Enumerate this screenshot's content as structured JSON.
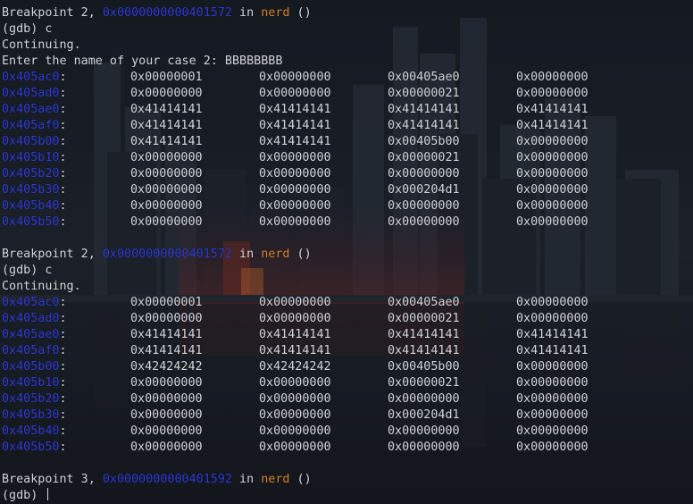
{
  "colors": {
    "background": "#15181f",
    "text": "#d3d6dc",
    "address": "#2f3bd6",
    "function": "#d7832a"
  },
  "blocks": [
    {
      "breakpoint": {
        "prefix": "Breakpoint 2, ",
        "address": "0x0000000000401572",
        "mid": " in ",
        "fn": "nerd",
        "suffix": " ()"
      },
      "prompt": "(gdb) c",
      "status": "Continuing.",
      "input_line": "Enter the name of your case 2: BBBBBBBB",
      "rows": [
        {
          "addr": "0x405ac0",
          "sep": ":",
          "words": [
            "0x00000001",
            "0x00000000",
            "0x00405ae0",
            "0x00000000"
          ]
        },
        {
          "addr": "0x405ad0",
          "sep": ":",
          "words": [
            "0x00000000",
            "0x00000000",
            "0x00000021",
            "0x00000000"
          ]
        },
        {
          "addr": "0x405ae0",
          "sep": ":",
          "words": [
            "0x41414141",
            "0x41414141",
            "0x41414141",
            "0x41414141"
          ]
        },
        {
          "addr": "0x405af0",
          "sep": ":",
          "words": [
            "0x41414141",
            "0x41414141",
            "0x41414141",
            "0x41414141"
          ]
        },
        {
          "addr": "0x405b00",
          "sep": ":",
          "words": [
            "0x41414141",
            "0x41414141",
            "0x00405b00",
            "0x00000000"
          ]
        },
        {
          "addr": "0x405b10",
          "sep": ":",
          "words": [
            "0x00000000",
            "0x00000000",
            "0x00000021",
            "0x00000000"
          ]
        },
        {
          "addr": "0x405b20",
          "sep": ":",
          "words": [
            "0x00000000",
            "0x00000000",
            "0x00000000",
            "0x00000000"
          ]
        },
        {
          "addr": "0x405b30",
          "sep": ":",
          "words": [
            "0x00000000",
            "0x00000000",
            "0x000204d1",
            "0x00000000"
          ]
        },
        {
          "addr": "0x405b40",
          "sep": ":",
          "words": [
            "0x00000000",
            "0x00000000",
            "0x00000000",
            "0x00000000"
          ]
        },
        {
          "addr": "0x405b50",
          "sep": ":",
          "words": [
            "0x00000000",
            "0x00000000",
            "0x00000000",
            "0x00000000"
          ]
        }
      ]
    },
    {
      "breakpoint": {
        "prefix": "Breakpoint 2, ",
        "address": "0x0000000000401572",
        "mid": " in ",
        "fn": "nerd",
        "suffix": " ()"
      },
      "prompt": "(gdb) c",
      "status": "Continuing.",
      "rows": [
        {
          "addr": "0x405ac0",
          "sep": ":",
          "words": [
            "0x00000001",
            "0x00000000",
            "0x00405ae0",
            "0x00000000"
          ]
        },
        {
          "addr": "0x405ad0",
          "sep": ":",
          "words": [
            "0x00000000",
            "0x00000000",
            "0x00000021",
            "0x00000000"
          ]
        },
        {
          "addr": "0x405ae0",
          "sep": ":",
          "words": [
            "0x41414141",
            "0x41414141",
            "0x41414141",
            "0x41414141"
          ]
        },
        {
          "addr": "0x405af0",
          "sep": ":",
          "words": [
            "0x41414141",
            "0x41414141",
            "0x41414141",
            "0x41414141"
          ]
        },
        {
          "addr": "0x405b00",
          "sep": ":",
          "words": [
            "0x42424242",
            "0x42424242",
            "0x00405b00",
            "0x00000000"
          ]
        },
        {
          "addr": "0x405b10",
          "sep": ":",
          "words": [
            "0x00000000",
            "0x00000000",
            "0x00000021",
            "0x00000000"
          ]
        },
        {
          "addr": "0x405b20",
          "sep": ":",
          "words": [
            "0x00000000",
            "0x00000000",
            "0x00000000",
            "0x00000000"
          ]
        },
        {
          "addr": "0x405b30",
          "sep": ":",
          "words": [
            "0x00000000",
            "0x00000000",
            "0x000204d1",
            "0x00000000"
          ]
        },
        {
          "addr": "0x405b40",
          "sep": ":",
          "words": [
            "0x00000000",
            "0x00000000",
            "0x00000000",
            "0x00000000"
          ]
        },
        {
          "addr": "0x405b50",
          "sep": ":",
          "words": [
            "0x00000000",
            "0x00000000",
            "0x00000000",
            "0x00000000"
          ]
        }
      ]
    }
  ],
  "final": {
    "breakpoint": {
      "prefix": "Breakpoint 3, ",
      "address": "0x0000000000401592",
      "mid": " in ",
      "fn": "nerd",
      "suffix": " ()"
    },
    "prompt": "(gdb) "
  }
}
